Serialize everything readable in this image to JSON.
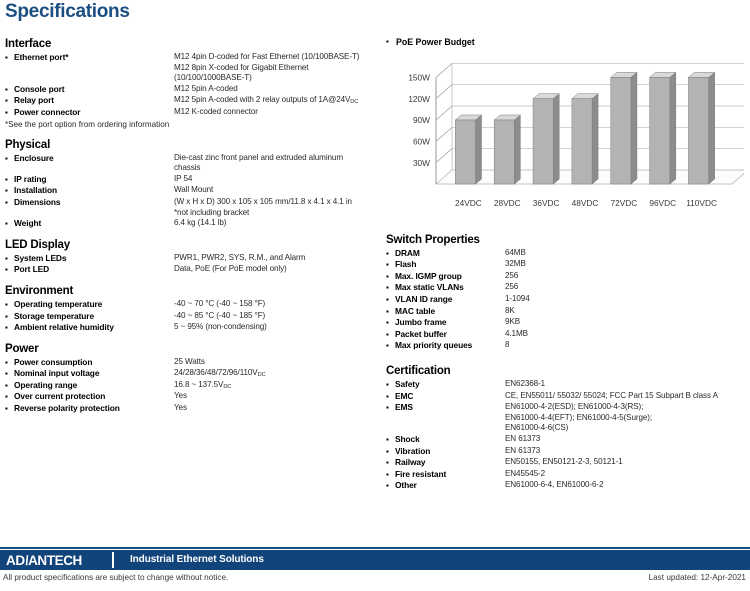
{
  "page_title": "Specifications",
  "bullet_glyph": "▪",
  "colors": {
    "title_blue": "#1b4f82",
    "footer_blue": "#12447c",
    "bar_fill": "#b3b3b3",
    "bar_side": "#8c8c8c",
    "bar_top": "#d9d9d9"
  },
  "left_sections": [
    {
      "title": "Interface",
      "rows": [
        {
          "label": "Ethernet port*",
          "value": "M12 4pin D-coded for Fast Ethernet (10/100BASE-T)\nM12 8pin X-coded for Gigabit Ethernet\n(10/100/1000BASE-T)"
        },
        {
          "label": "Console port",
          "value": "M12 5pin A-coded"
        },
        {
          "label": "Relay port",
          "value": "M12 5pin A-coded with 2 relay outputs of 1A@24V",
          "sub": "DC"
        },
        {
          "label": "Power connector",
          "value": "M12 K-coded connector"
        }
      ],
      "footnote": "*See the port option from ordering information"
    },
    {
      "title": "Physical",
      "rows": [
        {
          "label": "Enclosure",
          "value": "Die-cast zinc front panel and extruded aluminum\nchassis"
        },
        {
          "label": "IP rating",
          "value": "IP 54"
        },
        {
          "label": "Installation",
          "value": "Wall Mount"
        },
        {
          "label": "Dimensions",
          "value": "(W x H x D) 300 x 105 x 105 mm/11.8 x 4.1 x 4.1 in\n*not including bracket"
        },
        {
          "label": "Weight",
          "value": "6.4 kg (14.1 lb)"
        }
      ]
    },
    {
      "title": "LED Display",
      "rows": [
        {
          "label": "System LEDs",
          "value": "PWR1, PWR2, SYS, R.M., and Alarm"
        },
        {
          "label": "Port LED",
          "value": "Data, PoE (For PoE model only)"
        }
      ]
    },
    {
      "title": "Environment",
      "rows": [
        {
          "label": "Operating temperature",
          "value": "-40 ~ 70 °C (-40 ~ 158 °F)"
        },
        {
          "label": "Storage temperature",
          "value": "-40 ~ 85 °C (-40 ~ 185 °F)"
        },
        {
          "label": "Ambient relative humidity",
          "value": "5 ~ 95% (non-condensing)"
        }
      ]
    },
    {
      "title": "Power",
      "rows": [
        {
          "label": "Power consumption",
          "value": "25 Watts"
        },
        {
          "label": "Nominal input voltage",
          "value": "24/28/36/48/72/96/110V",
          "sub": "DC"
        },
        {
          "label": "Operating range",
          "value": "16.8 ~ 137.5V",
          "sub": "DC"
        },
        {
          "label": "Over current protection",
          "value": "Yes"
        },
        {
          "label": "Reverse polarity protection",
          "value": "Yes"
        }
      ]
    }
  ],
  "right_sections": [
    {
      "title": "Switch Properties",
      "rows": [
        {
          "label": "DRAM",
          "value": "64MB"
        },
        {
          "label": "Flash",
          "value": "32MB"
        },
        {
          "label": "Max. IGMP group",
          "value": "256"
        },
        {
          "label": "Max static VLANs",
          "value": "256"
        },
        {
          "label": "VLAN ID range",
          "value": "1-1094"
        },
        {
          "label": "MAC table",
          "value": "8K"
        },
        {
          "label": "Jumbo frame",
          "value": "9KB"
        },
        {
          "label": "Packet buffer",
          "value": "4.1MB"
        },
        {
          "label": "Max priority queues",
          "value": "8"
        }
      ]
    },
    {
      "title": "Certification",
      "rows": [
        {
          "label": "Safety",
          "value": "EN62368-1"
        },
        {
          "label": "EMC",
          "value": "CE, EN55011/ 55032/ 55024; FCC Part 15 Subpart B class A"
        },
        {
          "label": "EMS",
          "value": "EN61000-4-2(ESD); EN61000-4-3(RS);\nEN61000-4-4(EFT); EN61000-4-5(Surge);\nEN61000-4-6(CS)"
        },
        {
          "label": "Shock",
          "value": "EN 61373"
        },
        {
          "label": "Vibration",
          "value": "EN 61373"
        },
        {
          "label": "Railway",
          "value": "EN50155, EN50121-2-3, 50121-1"
        },
        {
          "label": "Fire resistant",
          "value": "EN45545-2"
        },
        {
          "label": "Other",
          "value": "EN61000-6-4, EN61000-6-2"
        }
      ]
    }
  ],
  "chart_data": {
    "type": "bar",
    "title": "PoE Power Budget",
    "categories": [
      "24VDC",
      "28VDC",
      "36VDC",
      "48VDC",
      "72VDC",
      "96VDC",
      "110VDC"
    ],
    "values": [
      90,
      90,
      120,
      120,
      150,
      150,
      150
    ],
    "ytick_labels": [
      "30W",
      "60W",
      "90W",
      "120W",
      "150W"
    ],
    "yticks": [
      30,
      60,
      90,
      120,
      150
    ],
    "ylim": [
      0,
      180
    ],
    "xlabel": "",
    "ylabel": "",
    "grid": true,
    "legend": "none",
    "style": "3d-column"
  },
  "footer": {
    "logo_pre": "AD",
    "logo_slash": "\\",
    "logo_post": "ANTECH",
    "tagline": "Industrial Ethernet Solutions",
    "note": "All product specifications are subject to change without notice.",
    "date": "Last updated: 12-Apr-2021"
  }
}
